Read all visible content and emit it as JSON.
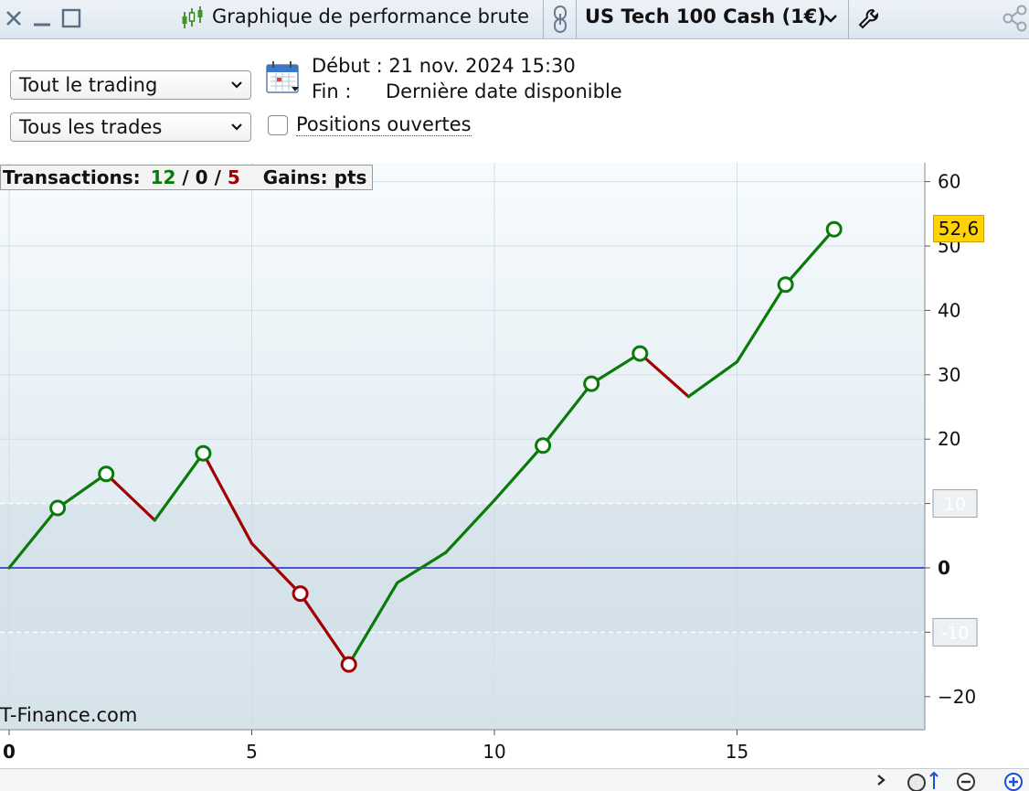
{
  "titlebar": {
    "title": "Graphique de performance brute",
    "instrument": "US Tech 100 Cash (1€)",
    "icons": [
      "close-icon",
      "minimize-icon",
      "maximize-icon",
      "candlestick-icon",
      "link-icon",
      "chevron-down-icon",
      "wrench-icon",
      "share-icon"
    ]
  },
  "controls": {
    "scope_select": "Tout le trading",
    "trades_select": "Tous les trades",
    "start_label": "Début :",
    "start_value": "21 nov. 2024 15:30",
    "end_label": "Fin :",
    "end_value": "Dernière date disponible",
    "open_positions_label": "Positions ouvertes",
    "open_positions_checked": false
  },
  "legend": {
    "transactions_label": "Transactions:",
    "wins": "12",
    "neutral": "0",
    "losses": "5",
    "gains_label": "Gains:",
    "gains_unit": "pts"
  },
  "watermark": "T-Finance.com",
  "last_value_label": "52,6",
  "colors": {
    "gain": "#0a7a0a",
    "loss": "#a00000",
    "zero_line": "#2222cc",
    "last_value_bg": "#ffd200"
  },
  "chart_data": {
    "type": "line",
    "x": [
      0,
      1,
      2,
      3,
      4,
      5,
      6,
      7,
      8,
      9,
      10,
      11,
      12,
      13,
      14,
      15,
      16,
      17
    ],
    "y": [
      0,
      9.3,
      14.6,
      7.4,
      17.8,
      3.8,
      -4,
      -15,
      -2.3,
      2.4,
      10.5,
      19,
      28.6,
      33.3,
      26.6,
      32,
      44,
      52.6
    ],
    "marked_points": [
      1,
      2,
      4,
      6,
      7,
      11,
      12,
      13,
      16,
      17
    ],
    "xlim": [
      0,
      19
    ],
    "ylim": [
      -26,
      62
    ],
    "x_ticks": [
      0,
      5,
      10,
      15
    ],
    "y_ticks": [
      -20,
      -10,
      0,
      10,
      20,
      30,
      40,
      50,
      60
    ],
    "y_tick_labels": [
      "−20",
      "-10",
      "0",
      "10",
      "20",
      "30",
      "40",
      "50",
      "60"
    ],
    "reference_lines": [
      10,
      -10
    ],
    "zero_line": 0,
    "grid": true,
    "last_value": 52.6
  }
}
